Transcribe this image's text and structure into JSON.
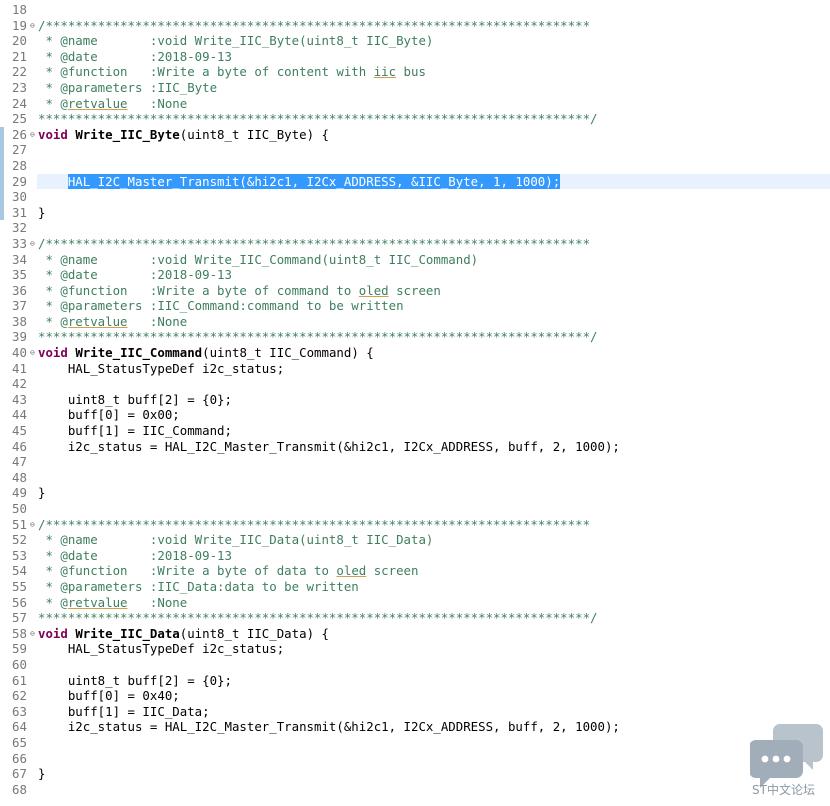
{
  "editor": {
    "lines": [
      {
        "n": "18",
        "t": ""
      },
      {
        "n": "19",
        "t": "/*************************************************************************",
        "fold": true
      },
      {
        "n": "20",
        "t": " * @name       :void Write_IIC_Byte(uint8_t IIC_Byte)"
      },
      {
        "n": "21",
        "t": " * @date       :2018-09-13"
      },
      {
        "n": "22",
        "t": " * @function   :Write a byte of content with iic bus"
      },
      {
        "n": "23",
        "t": " * @parameters :IIC_Byte"
      },
      {
        "n": "24",
        "t": " * @retvalue   :None"
      },
      {
        "n": "25",
        "t": "**************************************************************************/"
      },
      {
        "n": "26",
        "t": "void Write_IIC_Byte(uint8_t IIC_Byte) {",
        "fold": true
      },
      {
        "n": "27",
        "t": ""
      },
      {
        "n": "28",
        "t": ""
      },
      {
        "n": "29",
        "t": "    HAL_I2C_Master_Transmit(&hi2c1, I2Cx_ADDRESS, &IIC_Byte, 1, 1000);"
      },
      {
        "n": "30",
        "t": ""
      },
      {
        "n": "31",
        "t": "}"
      },
      {
        "n": "32",
        "t": ""
      },
      {
        "n": "33",
        "t": "/*************************************************************************",
        "fold": true
      },
      {
        "n": "34",
        "t": " * @name       :void Write_IIC_Command(uint8_t IIC_Command)"
      },
      {
        "n": "35",
        "t": " * @date       :2018-09-13"
      },
      {
        "n": "36",
        "t": " * @function   :Write a byte of command to oled screen"
      },
      {
        "n": "37",
        "t": " * @parameters :IIC_Command:command to be written"
      },
      {
        "n": "38",
        "t": " * @retvalue   :None"
      },
      {
        "n": "39",
        "t": "**************************************************************************/"
      },
      {
        "n": "40",
        "t": "void Write_IIC_Command(uint8_t IIC_Command) {",
        "fold": true
      },
      {
        "n": "41",
        "t": "    HAL_StatusTypeDef i2c_status;"
      },
      {
        "n": "42",
        "t": ""
      },
      {
        "n": "43",
        "t": "    uint8_t buff[2] = {0};"
      },
      {
        "n": "44",
        "t": "    buff[0] = 0x00;"
      },
      {
        "n": "45",
        "t": "    buff[1] = IIC_Command;"
      },
      {
        "n": "46",
        "t": "    i2c_status = HAL_I2C_Master_Transmit(&hi2c1, I2Cx_ADDRESS, buff, 2, 1000);"
      },
      {
        "n": "47",
        "t": ""
      },
      {
        "n": "48",
        "t": ""
      },
      {
        "n": "49",
        "t": "}"
      },
      {
        "n": "50",
        "t": ""
      },
      {
        "n": "51",
        "t": "/*************************************************************************",
        "fold": true
      },
      {
        "n": "52",
        "t": " * @name       :void Write_IIC_Data(uint8_t IIC_Data)"
      },
      {
        "n": "53",
        "t": " * @date       :2018-09-13"
      },
      {
        "n": "54",
        "t": " * @function   :Write a byte of data to oled screen"
      },
      {
        "n": "55",
        "t": " * @parameters :IIC_Data:data to be written"
      },
      {
        "n": "56",
        "t": " * @retvalue   :None"
      },
      {
        "n": "57",
        "t": "**************************************************************************/"
      },
      {
        "n": "58",
        "t": "void Write_IIC_Data(uint8_t IIC_Data) {",
        "fold": true
      },
      {
        "n": "59",
        "t": "    HAL_StatusTypeDef i2c_status;"
      },
      {
        "n": "60",
        "t": ""
      },
      {
        "n": "61",
        "t": "    uint8_t buff[2] = {0};"
      },
      {
        "n": "62",
        "t": "    buff[0] = 0x40;"
      },
      {
        "n": "63",
        "t": "    buff[1] = IIC_Data;"
      },
      {
        "n": "64",
        "t": "    i2c_status = HAL_I2C_Master_Transmit(&hi2c1, I2Cx_ADDRESS, buff, 2, 1000);"
      },
      {
        "n": "65",
        "t": ""
      },
      {
        "n": "66",
        "t": ""
      },
      {
        "n": "67",
        "t": "}"
      },
      {
        "n": "68",
        "t": ""
      }
    ],
    "highlight_line": "29",
    "marker_lines": [
      "26",
      "27",
      "28",
      "29",
      "30",
      "31"
    ]
  },
  "watermark": {
    "text": "ST中文论坛",
    "icon": "chat-bubbles-icon",
    "color": "#a7b3bd"
  },
  "colors": {
    "comment": "#3f7f5f",
    "keyword": "#7f0055",
    "selection": "#3399ff",
    "current_line": "#e8f2fe"
  }
}
